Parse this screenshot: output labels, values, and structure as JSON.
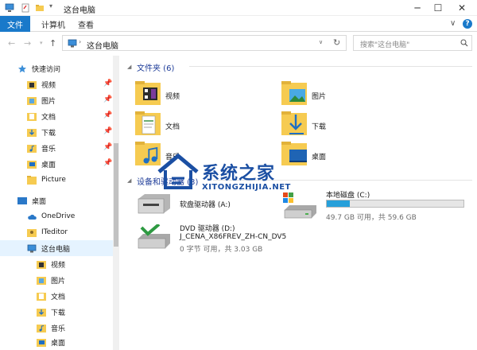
{
  "window": {
    "title": "这台电脑",
    "minimize": "─",
    "maximize": "☐",
    "close": "✕"
  },
  "ribbon": {
    "tabs": [
      "文件",
      "计算机",
      "查看"
    ],
    "expand": "∨",
    "help": "?"
  },
  "address": {
    "path": "这台电脑",
    "search_placeholder": "搜索\"这台电脑\""
  },
  "nav_pane": {
    "quick_access": "快速访问",
    "quick_items": [
      "视频",
      "图片",
      "文档",
      "下载",
      "音乐",
      "桌面",
      "Picture"
    ],
    "desktop": "桌面",
    "onedrive": "OneDrive",
    "iteditor": "ITeditor",
    "this_pc": "这台电脑",
    "pc_items": [
      "视频",
      "图片",
      "文档",
      "下载",
      "音乐",
      "桌面"
    ]
  },
  "folders": {
    "title": "文件夹 (6)",
    "items": [
      "视频",
      "图片",
      "文档",
      "下载",
      "音乐",
      "桌面"
    ]
  },
  "devices": {
    "title": "设备和驱动器 (3)",
    "floppy": "软盘驱动器 (A:)",
    "local_disk": {
      "name": "本地磁盘 (C:)",
      "info": "49.7 GB 可用，共 59.6 GB",
      "used_fraction": 0.17
    },
    "dvd": {
      "name": "DVD 驱动器 (D:)",
      "label": "J_CENA_X86FREV_ZH-CN_DV5",
      "info": "0 字节 可用，共 3.03 GB"
    }
  },
  "watermark": {
    "text": "系统之家",
    "url": "XITONGZHIJIA.NET"
  }
}
